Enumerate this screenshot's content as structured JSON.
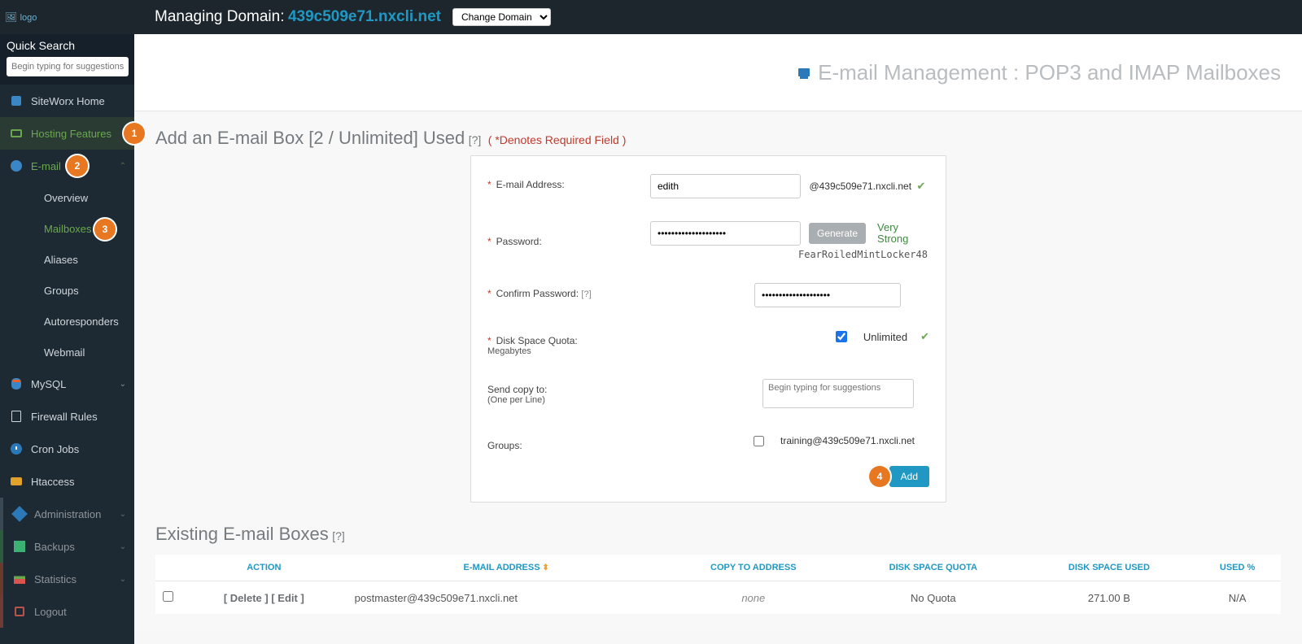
{
  "topbar": {
    "managing_label": "Managing Domain:",
    "domain": "439c509e71.nxcli.net",
    "change_domain": "Change Domain"
  },
  "sidebar": {
    "quick_search_title": "Quick Search",
    "quick_search_placeholder": "Begin typing for suggestions",
    "home": "SiteWorx Home",
    "hosting_features": "Hosting Features",
    "email": "E-mail",
    "email_sub": {
      "overview": "Overview",
      "mailboxes": "Mailboxes",
      "aliases": "Aliases",
      "groups": "Groups",
      "autoresponders": "Autoresponders",
      "webmail": "Webmail"
    },
    "mysql": "MySQL",
    "firewall": "Firewall Rules",
    "cron": "Cron Jobs",
    "htaccess": "Htaccess",
    "administration": "Administration",
    "backups": "Backups",
    "statistics": "Statistics",
    "logout": "Logout"
  },
  "badges": {
    "b1": "1",
    "b2": "2",
    "b3": "3",
    "b4": "4"
  },
  "page": {
    "title": "E-mail Management : POP3 and IMAP Mailboxes",
    "add_heading": "Add an E-mail Box [2 / Unlimited] Used",
    "help": "[?]",
    "req_note": "( *Denotes Required Field )"
  },
  "form": {
    "email_label": "E-mail Address:",
    "email_value": "edith",
    "email_domain": "@439c509e71.nxcli.net",
    "password_label": "Password:",
    "password_value": "••••••••••••••••••••",
    "generate": "Generate",
    "strength": "Very Strong",
    "password_hint": "FearRoiledMintLocker48",
    "confirm_label": "Confirm Password:",
    "confirm_help": "[?]",
    "confirm_value": "••••••••••••••••••••",
    "quota_label": "Disk Space Quota:",
    "quota_sub": "Megabytes",
    "quota_unlimited": "Unlimited",
    "sendcopy_label": "Send copy to:",
    "sendcopy_sub": "(One per Line)",
    "sendcopy_placeholder": "Begin typing for suggestions",
    "groups_label": "Groups:",
    "group_option": "training@439c509e71.nxcli.net",
    "add_btn": "Add"
  },
  "existing": {
    "heading": "Existing E-mail Boxes",
    "help": "[?]",
    "cols": {
      "action": "Action",
      "email": "E-mail Address",
      "copy": "Copy To Address",
      "quota": "Disk Space Quota",
      "used": "Disk Space Used",
      "usedpct": "Used %"
    },
    "rows": [
      {
        "delete": "[ Delete ]",
        "edit": "[ Edit ]",
        "email": "postmaster@439c509e71.nxcli.net",
        "copy": "none",
        "quota": "No Quota",
        "used": "271.00 B",
        "usedpct": "N/A"
      }
    ]
  }
}
